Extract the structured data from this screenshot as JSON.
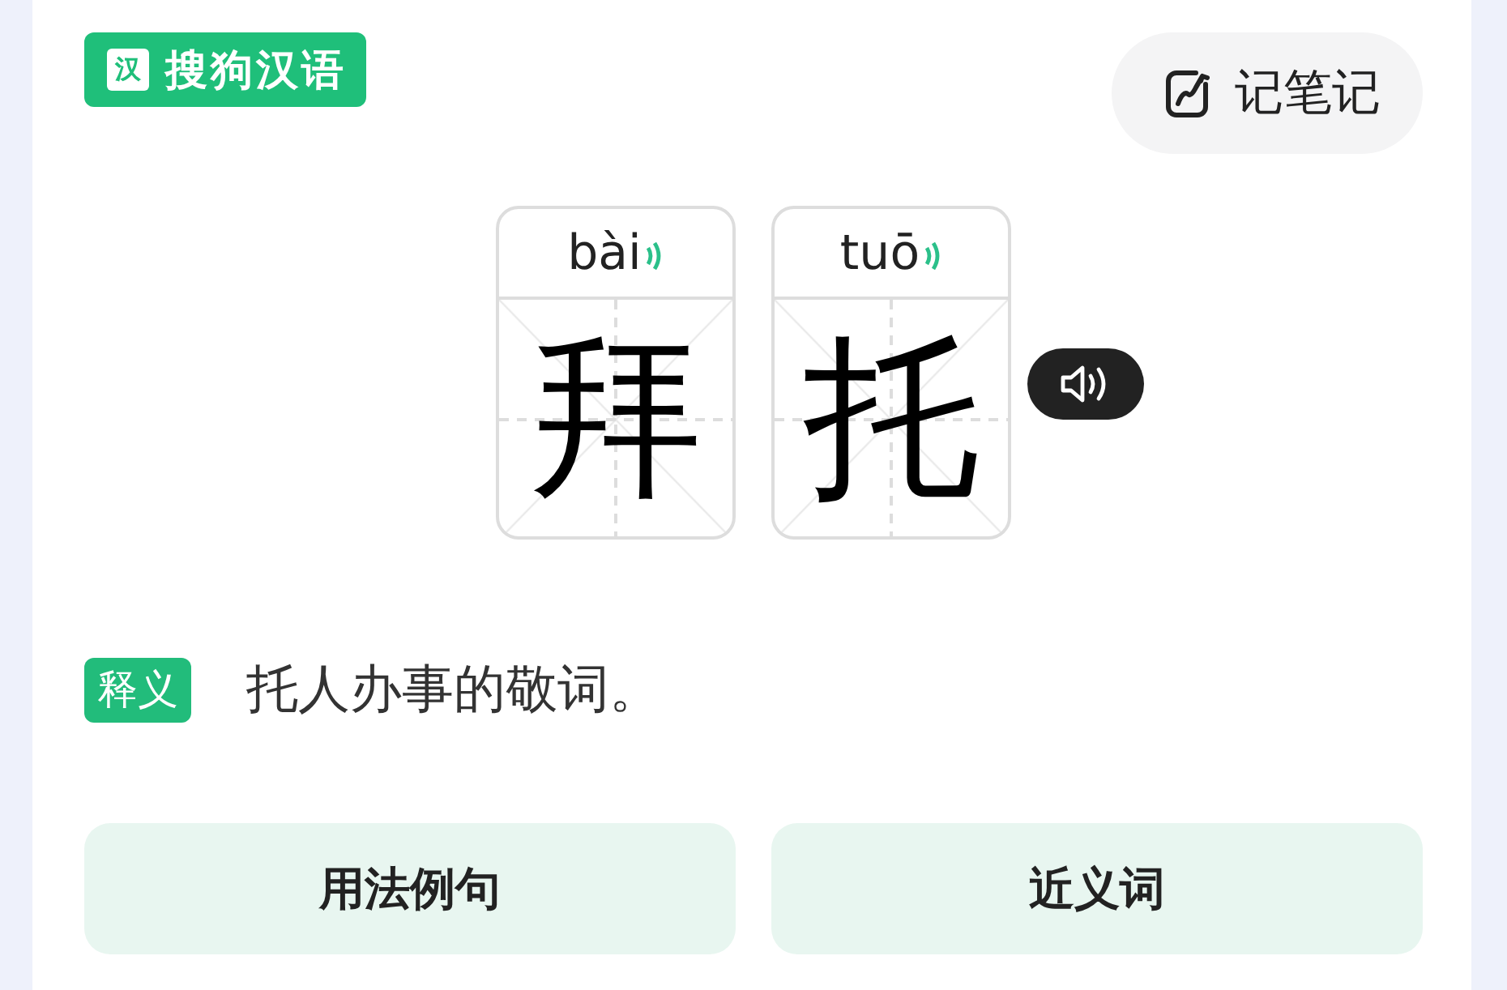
{
  "logo": {
    "icon_char": "汉",
    "text": "搜狗汉语"
  },
  "note_button": {
    "label": "记笔记"
  },
  "characters": [
    {
      "pinyin": "bài",
      "char": "拜"
    },
    {
      "pinyin": "tuō",
      "char": "托"
    }
  ],
  "definition": {
    "tag": "释义",
    "text": "托人办事的敬词。"
  },
  "buttons": [
    {
      "label": "用法例句"
    },
    {
      "label": "近义词"
    }
  ]
}
